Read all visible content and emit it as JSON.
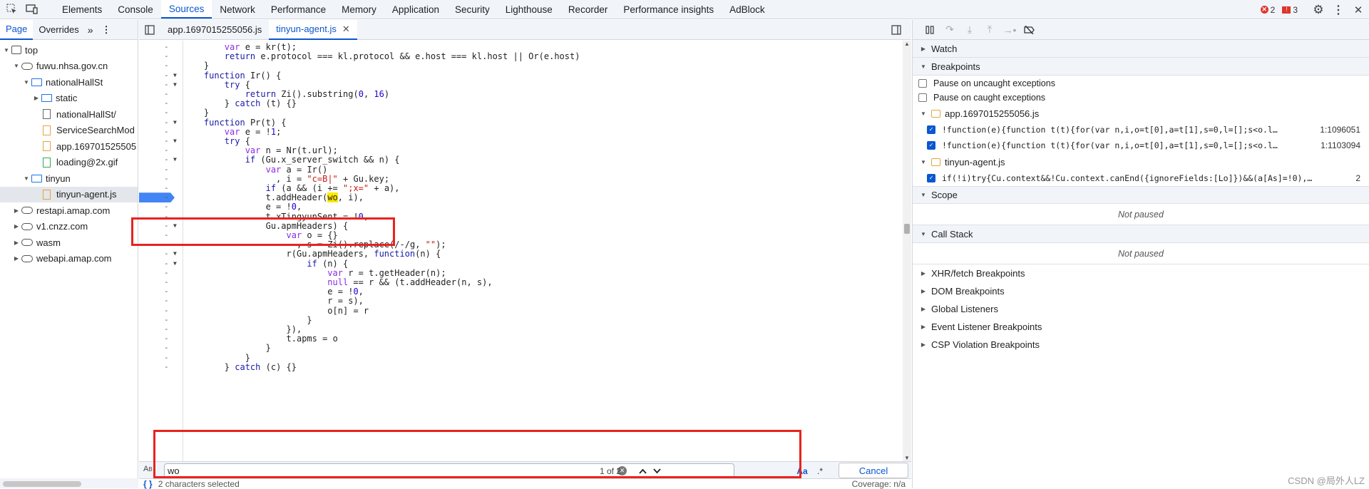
{
  "toolbar": {
    "tabs": [
      "Elements",
      "Console",
      "Sources",
      "Network",
      "Performance",
      "Memory",
      "Application",
      "Security",
      "Lighthouse",
      "Recorder",
      "Performance insights",
      "AdBlock"
    ],
    "active_tab": "Sources",
    "errors": "2",
    "warnings": "3"
  },
  "navigator": {
    "tabs": [
      "Page",
      "Overrides"
    ],
    "active": "Page",
    "tree": [
      {
        "label": "top",
        "depth": 0,
        "arrow": "▼",
        "icon": "frame"
      },
      {
        "label": "fuwu.nhsa.gov.cn",
        "depth": 1,
        "arrow": "▼",
        "icon": "cloud"
      },
      {
        "label": "nationalHallSt",
        "depth": 2,
        "arrow": "▼",
        "icon": "folder"
      },
      {
        "label": "static",
        "depth": 3,
        "arrow": "▶",
        "icon": "folder"
      },
      {
        "label": "nationalHallSt/",
        "depth": 3,
        "arrow": "",
        "icon": "file"
      },
      {
        "label": "ServiceSearchMod",
        "depth": 3,
        "arrow": "",
        "icon": "file-js"
      },
      {
        "label": "app.169701525505",
        "depth": 3,
        "arrow": "",
        "icon": "file-js"
      },
      {
        "label": "loading@2x.gif",
        "depth": 3,
        "arrow": "",
        "icon": "file-img"
      },
      {
        "label": "tinyun",
        "depth": 2,
        "arrow": "▼",
        "icon": "folder"
      },
      {
        "label": "tinyun-agent.js",
        "depth": 3,
        "arrow": "",
        "icon": "file-js",
        "selected": true
      },
      {
        "label": "restapi.amap.com",
        "depth": 1,
        "arrow": "▶",
        "icon": "cloud"
      },
      {
        "label": "v1.cnzz.com",
        "depth": 1,
        "arrow": "▶",
        "icon": "cloud"
      },
      {
        "label": "wasm",
        "depth": 1,
        "arrow": "▶",
        "icon": "cloud"
      },
      {
        "label": "webapi.amap.com",
        "depth": 1,
        "arrow": "▶",
        "icon": "cloud"
      }
    ]
  },
  "editor": {
    "tabs": [
      "app.1697015255056.js",
      "tinyun-agent.js"
    ],
    "active_tab": "tinyun-agent.js",
    "lines": [
      {
        "indent": 8,
        "text": "var e = kr(t);",
        "fold": false
      },
      {
        "indent": 8,
        "text": "return e.protocol === kl.protocol && e.host === kl.host || Or(e.host)",
        "fold": false
      },
      {
        "indent": 4,
        "text": "}",
        "fold": false
      },
      {
        "indent": 4,
        "text": "function Ir() {",
        "fold": true
      },
      {
        "indent": 8,
        "text": "try {",
        "fold": true
      },
      {
        "indent": 12,
        "text": "return Zi().substring(0, 16)",
        "fold": false
      },
      {
        "indent": 8,
        "text": "} catch (t) {}",
        "fold": false
      },
      {
        "indent": 4,
        "text": "}",
        "fold": false
      },
      {
        "indent": 4,
        "text": "function Pr(t) {",
        "fold": true
      },
      {
        "indent": 8,
        "text": "var e = !1;",
        "fold": false
      },
      {
        "indent": 8,
        "text": "try {",
        "fold": true
      },
      {
        "indent": 12,
        "text": "var n = Nr(t.url);",
        "fold": false
      },
      {
        "indent": 12,
        "text": "if (Gu.x_server_switch && n) {",
        "fold": true
      },
      {
        "indent": 16,
        "text": "var a = Ir()",
        "fold": false
      },
      {
        "indent": 18,
        "text": ", i = \"c=B|\" + Gu.key;",
        "fold": false
      },
      {
        "indent": 16,
        "text": "if (a && (i += \";x=\" + a),",
        "fold": false
      },
      {
        "indent": 16,
        "text": "t.addHeader(wo, i),",
        "fold": false,
        "breakpoint": true,
        "highlight": "wo"
      },
      {
        "indent": 16,
        "text": "e = !0,",
        "fold": false
      },
      {
        "indent": 16,
        "text": "t.xTingyunSent = !0,",
        "fold": false
      },
      {
        "indent": 16,
        "text": "Gu.apmHeaders) {",
        "fold": true
      },
      {
        "indent": 20,
        "text": "var o = {}",
        "fold": false
      },
      {
        "indent": 22,
        "text": ", s = Zi().replace(/-/g, \"\");",
        "fold": false
      },
      {
        "indent": 20,
        "text": "r(Gu.apmHeaders, function(n) {",
        "fold": true
      },
      {
        "indent": 24,
        "text": "if (n) {",
        "fold": true
      },
      {
        "indent": 28,
        "text": "var r = t.getHeader(n);",
        "fold": false
      },
      {
        "indent": 28,
        "text": "null == r && (t.addHeader(n, s),",
        "fold": false
      },
      {
        "indent": 28,
        "text": "e = !0,",
        "fold": false
      },
      {
        "indent": 28,
        "text": "r = s),",
        "fold": false
      },
      {
        "indent": 28,
        "text": "o[n] = r",
        "fold": false
      },
      {
        "indent": 24,
        "text": "}",
        "fold": false
      },
      {
        "indent": 20,
        "text": "}),",
        "fold": false
      },
      {
        "indent": 20,
        "text": "t.apms = o",
        "fold": false
      },
      {
        "indent": 16,
        "text": "}",
        "fold": false
      },
      {
        "indent": 12,
        "text": "}",
        "fold": false
      },
      {
        "indent": 8,
        "text": "} catch (c) {}",
        "fold": false
      }
    ]
  },
  "search": {
    "value": "wo",
    "count": "1 of 2",
    "aa": "Aa",
    "regex": ".*",
    "cancel": "Cancel"
  },
  "status": {
    "selected": "2 characters selected",
    "coverage": "Coverage: n/a"
  },
  "debugger": {
    "watch": "Watch",
    "breakpoints": "Breakpoints",
    "pause_uncaught": "Pause on uncaught exceptions",
    "pause_caught": "Pause on caught exceptions",
    "files": [
      {
        "name": "app.1697015255056.js",
        "entries": [
          {
            "code": "!function(e){function t(t){for(var n,i,o=t[0],a=t[1],s=0,l=[];s<o.l…",
            "line": "1:1096051"
          },
          {
            "code": "!function(e){function t(t){for(var n,i,o=t[0],a=t[1],s=0,l=[];s<o.l…",
            "line": "1:1103094"
          }
        ]
      },
      {
        "name": "tinyun-agent.js",
        "entries": [
          {
            "code": "if(!i)try{Cu.context&&!Cu.context.canEnd({ignoreFields:[Lo]})&&(a[As]=!0),…",
            "line": "2"
          }
        ]
      }
    ],
    "scope": "Scope",
    "not_paused": "Not paused",
    "call_stack": "Call Stack",
    "others": [
      "XHR/fetch Breakpoints",
      "DOM Breakpoints",
      "Global Listeners",
      "Event Listener Breakpoints",
      "CSP Violation Breakpoints"
    ]
  },
  "watermark": "CSDN @局外人LZ"
}
